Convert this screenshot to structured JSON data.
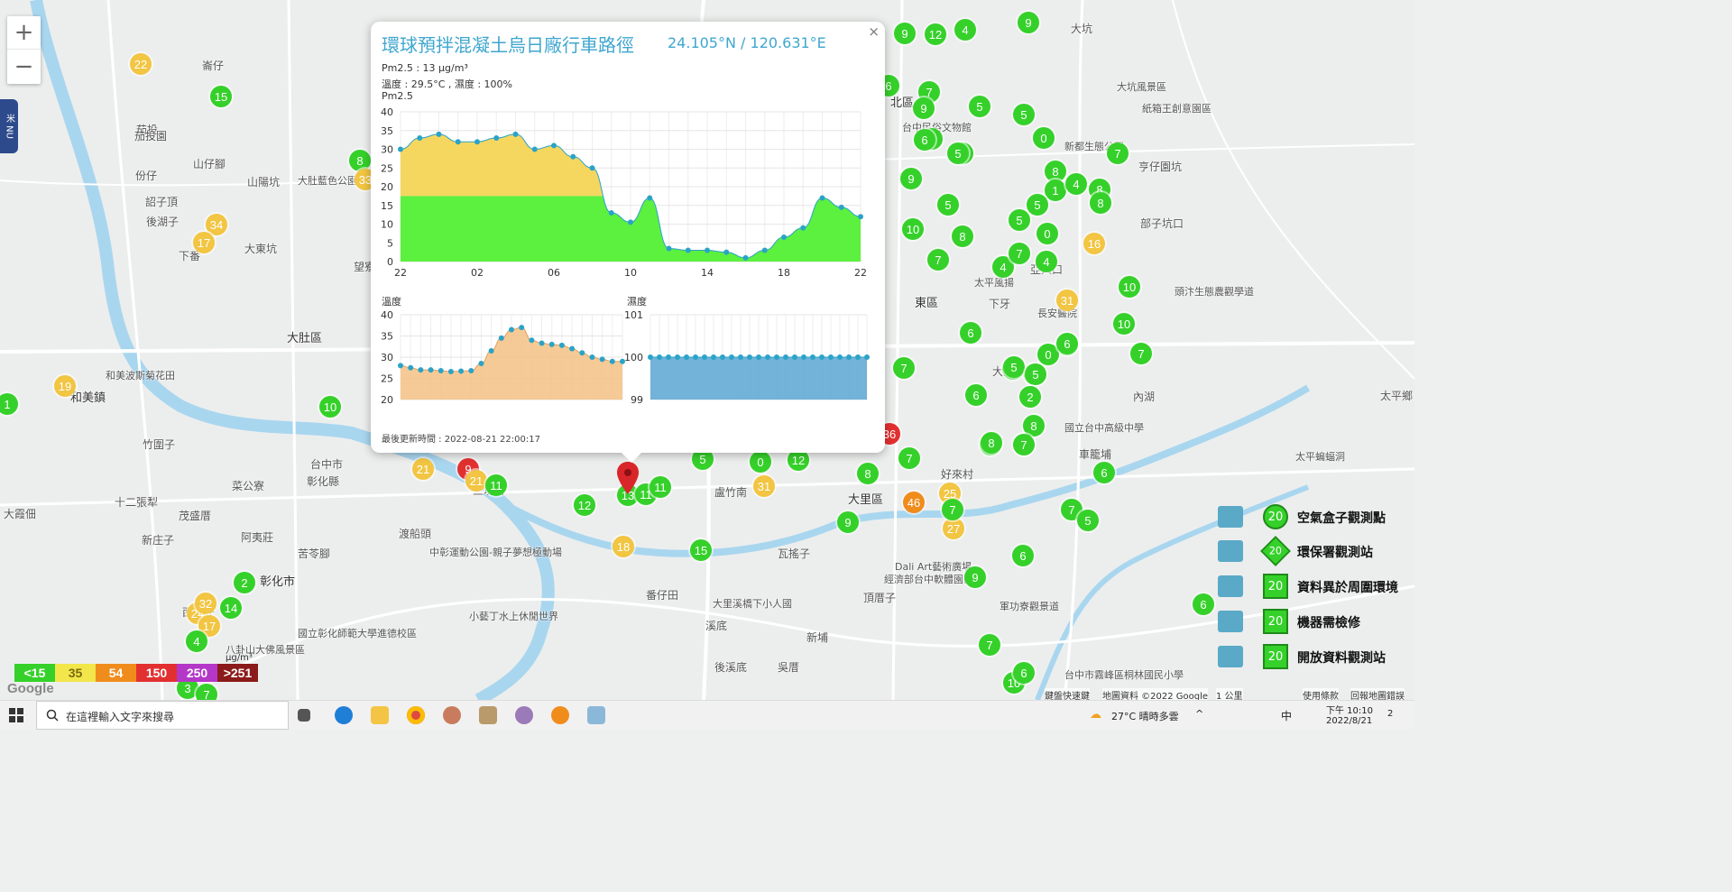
{
  "map": {
    "zoom_in": "+",
    "zoom_out": "−",
    "menu_tab": "米 NU",
    "places": [
      {
        "name": "大肚區",
        "big": true
      },
      {
        "name": "和美鎮",
        "big": true
      },
      {
        "name": "彰化市",
        "big": true
      },
      {
        "name": "大里區",
        "big": true
      },
      {
        "name": "東區",
        "big": true
      },
      {
        "name": "北區",
        "big": true
      },
      {
        "name": "大坑"
      },
      {
        "name": "崙仔"
      },
      {
        "name": "茄投"
      },
      {
        "name": "茄投園"
      },
      {
        "name": "份仔"
      },
      {
        "name": "山仔腳"
      },
      {
        "name": "山陽坑"
      },
      {
        "name": "詔子頂"
      },
      {
        "name": "後湖子"
      },
      {
        "name": "下番"
      },
      {
        "name": "大東坑"
      },
      {
        "name": "望寮"
      },
      {
        "name": "竹圍子"
      },
      {
        "name": "十二張犁"
      },
      {
        "name": "大霞佃"
      },
      {
        "name": "茂盛厝"
      },
      {
        "name": "新庄子"
      },
      {
        "name": "阿夷莊"
      },
      {
        "name": "苦苓腳"
      },
      {
        "name": "渡船頭"
      },
      {
        "name": "菜公寮"
      },
      {
        "name": "台中市"
      },
      {
        "name": "彰化縣"
      },
      {
        "name": "三塊厝"
      },
      {
        "name": "西勢仔"
      },
      {
        "name": "番仔田"
      },
      {
        "name": "溪底"
      },
      {
        "name": "後溪底"
      },
      {
        "name": "吳厝"
      },
      {
        "name": "新埔"
      },
      {
        "name": "頂厝子"
      },
      {
        "name": "瓦搖子"
      },
      {
        "name": "盧竹南"
      },
      {
        "name": "好來村"
      },
      {
        "name": "亨仔園坑"
      },
      {
        "name": "部子坑口"
      },
      {
        "name": "內湖"
      },
      {
        "name": "車籠埔"
      },
      {
        "name": "大里杙"
      },
      {
        "name": "太平鄉"
      },
      {
        "name": "亞人口"
      },
      {
        "name": "下牙"
      }
    ],
    "pois": [
      "大坑風景區",
      "紙箱王創意園區",
      "大肚藍色公園",
      "和美波斯菊花田",
      "國立彰化師範大學進德校區",
      "八卦山大佛風景區",
      "中彰運動公園-親子夢想極動場",
      "小藝丁水上休閒世界",
      "大里溪橋下小人國",
      "Dali Art藝術廣場",
      "經濟部台中軟體園區",
      "台中市霧峰區桐林國民小學",
      "國立台中高級中學",
      "軍功寮觀景道",
      "頭汴生態農觀學道",
      "長安醫院",
      "太平風揚",
      "太平蝙蝠洞",
      "台中民俗文物館",
      "新都生態公園"
    ],
    "markers": [
      {
        "value": "22",
        "level": "y"
      },
      {
        "value": "15",
        "level": "g"
      },
      {
        "value": "8",
        "level": "g"
      },
      {
        "value": "33",
        "level": "y"
      },
      {
        "value": "34",
        "level": "y"
      },
      {
        "value": "17",
        "level": "y"
      },
      {
        "value": "19",
        "level": "y"
      },
      {
        "value": "10",
        "level": "g"
      },
      {
        "value": "1",
        "level": "g"
      },
      {
        "value": "2",
        "level": "g"
      },
      {
        "value": "14",
        "level": "g"
      },
      {
        "value": "24",
        "level": "y"
      },
      {
        "value": "32",
        "level": "y"
      },
      {
        "value": "17",
        "level": "y"
      },
      {
        "value": "4",
        "level": "g"
      },
      {
        "value": "3",
        "level": "g"
      },
      {
        "value": "7",
        "level": "g"
      },
      {
        "value": "21",
        "level": "y"
      },
      {
        "value": "9",
        "level": "r"
      },
      {
        "value": "21",
        "level": "y"
      },
      {
        "value": "11",
        "level": "g"
      },
      {
        "value": "12",
        "level": "g"
      },
      {
        "value": "13",
        "level": "g"
      },
      {
        "value": "11",
        "level": "g"
      },
      {
        "value": "11",
        "level": "g"
      },
      {
        "value": "18",
        "level": "y"
      },
      {
        "value": "15",
        "level": "g"
      },
      {
        "value": "5",
        "level": "g"
      },
      {
        "value": "0",
        "level": "g"
      },
      {
        "value": "12",
        "level": "g"
      },
      {
        "value": "31",
        "level": "y"
      },
      {
        "value": "8",
        "level": "g"
      },
      {
        "value": "9",
        "level": "g"
      },
      {
        "value": "46",
        "level": "o"
      },
      {
        "value": "25",
        "level": "y"
      },
      {
        "value": "27",
        "level": "y"
      },
      {
        "value": "7",
        "level": "g"
      },
      {
        "value": "36",
        "level": "r"
      },
      {
        "value": "7",
        "level": "g"
      },
      {
        "value": "6",
        "level": "g"
      },
      {
        "value": "9",
        "level": "g"
      },
      {
        "value": "6",
        "level": "g"
      },
      {
        "value": "8",
        "level": "g"
      },
      {
        "value": "5",
        "level": "g"
      },
      {
        "value": "9",
        "level": "g"
      },
      {
        "value": "6",
        "level": "g"
      },
      {
        "value": "7",
        "level": "g"
      },
      {
        "value": "9",
        "level": "g"
      },
      {
        "value": "6",
        "level": "g"
      },
      {
        "value": "10",
        "level": "g"
      },
      {
        "value": "5",
        "level": "g"
      },
      {
        "value": "10",
        "level": "g"
      },
      {
        "value": "7",
        "level": "g"
      },
      {
        "value": "2",
        "level": "g"
      },
      {
        "value": "8",
        "level": "g"
      },
      {
        "value": "9",
        "level": "g"
      },
      {
        "value": "5",
        "level": "g"
      },
      {
        "value": "0",
        "level": "g"
      },
      {
        "value": "7",
        "level": "g"
      },
      {
        "value": "8",
        "level": "g"
      },
      {
        "value": "1",
        "level": "g"
      },
      {
        "value": "4",
        "level": "g"
      },
      {
        "value": "4",
        "level": "g"
      },
      {
        "value": "5",
        "level": "g"
      },
      {
        "value": "0",
        "level": "g"
      },
      {
        "value": "7",
        "level": "g"
      },
      {
        "value": "8",
        "level": "g"
      },
      {
        "value": "4",
        "level": "g"
      },
      {
        "value": "16",
        "level": "y"
      },
      {
        "value": "31",
        "level": "y"
      },
      {
        "value": "7",
        "level": "g"
      },
      {
        "value": "10",
        "level": "g"
      },
      {
        "value": "7",
        "level": "g"
      },
      {
        "value": "6",
        "level": "g"
      },
      {
        "value": "5",
        "level": "g"
      },
      {
        "value": "5",
        "level": "g"
      },
      {
        "value": "0",
        "level": "g"
      },
      {
        "value": "6",
        "level": "g"
      },
      {
        "value": "2",
        "level": "g"
      },
      {
        "value": "7",
        "level": "g"
      },
      {
        "value": "8",
        "level": "g"
      },
      {
        "value": "5",
        "level": "g"
      },
      {
        "value": "9",
        "level": "g"
      },
      {
        "value": "6",
        "level": "g"
      },
      {
        "value": "7",
        "level": "g"
      },
      {
        "value": "10",
        "level": "g"
      },
      {
        "value": "6",
        "level": "g"
      },
      {
        "value": "6",
        "level": "g"
      },
      {
        "value": "5",
        "level": "g"
      },
      {
        "value": "9",
        "level": "g"
      },
      {
        "value": "12",
        "level": "g"
      },
      {
        "value": "4",
        "level": "g"
      },
      {
        "value": "9",
        "level": "g"
      },
      {
        "value": "6",
        "level": "g"
      },
      {
        "value": "7",
        "level": "g"
      },
      {
        "value": "9",
        "level": "g"
      },
      {
        "value": "6",
        "level": "g"
      },
      {
        "value": "5",
        "level": "g"
      },
      {
        "value": "8",
        "level": "g"
      },
      {
        "value": "5",
        "level": "g"
      }
    ],
    "colors": {
      "green": "#35d12a",
      "yellow": "#f2c542",
      "orange": "#f08c1c",
      "red": "#e23030",
      "river": "#a9d6ef"
    }
  },
  "popup": {
    "close_label": "×",
    "title": "環球預拌混凝土烏日廠行車路徑",
    "coords": "24.105°N / 120.631°E",
    "pm25_line": "Pm2.5 : 13 μg/m³",
    "temp_humid_line": "溫度 : 29.5°C , 濕度 : 100%",
    "pm25_label": "Pm2.5",
    "temp_label": "溫度",
    "humid_label": "濕度",
    "updated": "最後更新時間 : 2022-08-21 22:00:17"
  },
  "chart_data": [
    {
      "type": "area",
      "title": "Pm2.5",
      "x_ticks": [
        "22",
        "02",
        "06",
        "10",
        "14",
        "18",
        "22"
      ],
      "y_ticks": [
        "0",
        "5",
        "10",
        "15",
        "20",
        "25",
        "30",
        "35",
        "40"
      ],
      "ylim": [
        0,
        40
      ],
      "threshold": 17.5,
      "values": [
        30,
        33,
        34,
        32,
        32,
        33,
        34,
        30,
        31,
        28,
        25,
        13,
        10.5,
        17,
        3.5,
        3,
        3,
        2.5,
        1,
        3,
        6.5,
        9,
        17,
        14.5,
        12
      ],
      "colors": {
        "low": "#5cf03f",
        "mid": "#f5d760"
      }
    },
    {
      "type": "area",
      "title": "溫度",
      "y_ticks": [
        "20",
        "25",
        "30",
        "35",
        "40"
      ],
      "ylim": [
        20,
        40
      ],
      "values": [
        28,
        27.5,
        27,
        27,
        26.8,
        26.6,
        26.7,
        26.8,
        28.5,
        31.5,
        34.5,
        36.5,
        37,
        34,
        33.3,
        33,
        32.8,
        32,
        31,
        30,
        29.5,
        29,
        29
      ],
      "colors": {
        "fill": "#f5c184",
        "line": "#2ba3c8"
      }
    },
    {
      "type": "area",
      "title": "濕度",
      "y_ticks": [
        "99",
        "100",
        "101"
      ],
      "ylim": [
        99,
        101
      ],
      "values": [
        100,
        100,
        100,
        100,
        100,
        100,
        100,
        100,
        100,
        100,
        100,
        100,
        100,
        100,
        100,
        100,
        100,
        100,
        100,
        100,
        100,
        100,
        100,
        100,
        100
      ],
      "colors": {
        "fill": "#5ba6d2",
        "line": "#2ba3c8"
      }
    }
  ],
  "legend": {
    "items": [
      {
        "label": "空氣盒子觀測點",
        "value": "20"
      },
      {
        "label": "環保署觀測站",
        "value": "20"
      },
      {
        "label": "資料異於周圍環境",
        "value": "20"
      },
      {
        "label": "機器需檢修",
        "value": "20"
      },
      {
        "label": "開放資料觀測站",
        "value": "20"
      }
    ]
  },
  "scale": {
    "bins": [
      {
        "label": "<15",
        "color": "#35d12a"
      },
      {
        "label": "35",
        "color": "#f2e64a"
      },
      {
        "label": "54",
        "color": "#f08c1c"
      },
      {
        "label": "150",
        "color": "#e23030"
      },
      {
        "label": "250",
        "color": "#b437c8"
      },
      {
        "label": ">251",
        "color": "#8b1a1a"
      }
    ],
    "unit": "μg/m³"
  },
  "footer": {
    "google": "Google",
    "shortcuts": "鍵盤快速鍵",
    "map_data": "地圖資料 ©2022 Google",
    "scale": "1 公里",
    "terms": "使用條款",
    "report": "回報地圖錯誤"
  },
  "taskbar": {
    "search_placeholder": "在這裡輸入文字來搜尋",
    "weather": "27°C 晴時多雲",
    "ime": "中",
    "time": "下午 10:10",
    "date": "2022/8/21",
    "notif_count": "2"
  }
}
